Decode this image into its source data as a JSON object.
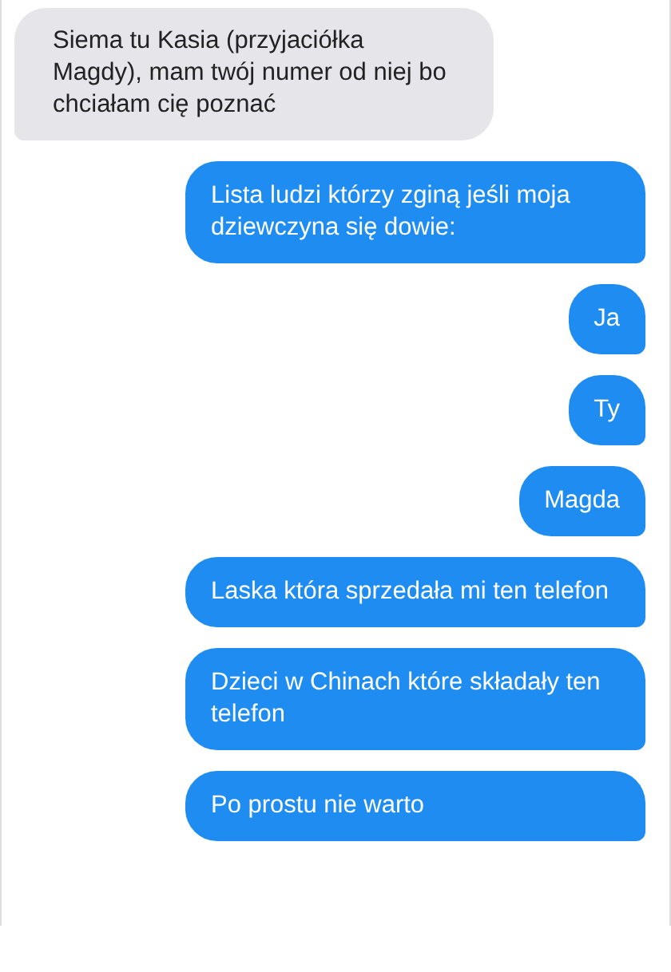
{
  "messages": [
    {
      "kind": "received",
      "text": "Siema tu Kasia (przyjaciółka Magdy), mam twój numer od niej bo chciałam cię poznać"
    },
    {
      "kind": "sent",
      "text": "Lista ludzi którzy zginą jeśli moja dziewczyna się dowie:"
    },
    {
      "kind": "sent",
      "text": "Ja"
    },
    {
      "kind": "sent",
      "text": "Ty"
    },
    {
      "kind": "sent",
      "text": "Magda"
    },
    {
      "kind": "sent",
      "text": "Laska która sprzedała mi ten telefon"
    },
    {
      "kind": "sent",
      "text": "Dzieci w Chinach które składały ten telefon"
    },
    {
      "kind": "sent",
      "text": "Po prostu nie warto"
    }
  ]
}
